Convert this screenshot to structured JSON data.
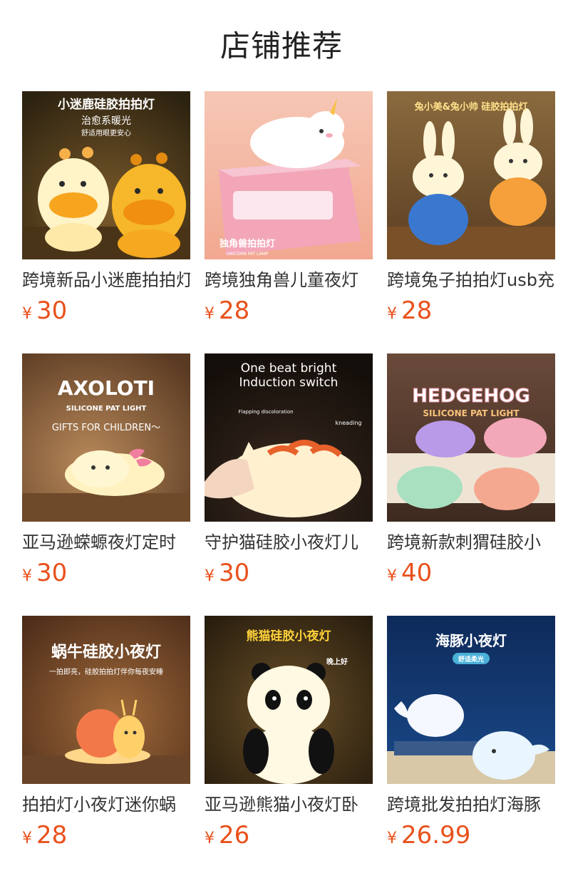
{
  "title": "店铺推荐",
  "currency_symbol": "¥",
  "products": [
    {
      "name": "跨境新品小迷鹿拍拍灯",
      "price": "30",
      "image": {
        "icon": "giraffe-lamp",
        "lines": [
          "小迷鹿硅胶拍拍灯",
          "治愈系暖光",
          "舒适用眼更安心"
        ]
      }
    },
    {
      "name": "跨境独角兽儿童夜灯",
      "price": "28",
      "image": {
        "icon": "unicorn-lamp",
        "lines": [
          "独角兽拍拍灯",
          "UNICORN PAT LAMP"
        ]
      }
    },
    {
      "name": "跨境兔子拍拍灯usb充",
      "price": "28",
      "image": {
        "icon": "rabbit-lamp",
        "lines": [
          "兔小美&兔小帅 硅胶拍拍灯"
        ]
      }
    },
    {
      "name": "亚马逊蝾螈夜灯定时",
      "price": "30",
      "image": {
        "icon": "axolotl-lamp",
        "lines": [
          "AXOLOTI",
          "SILICONE PAT LIGHT",
          "GIFTS FOR CHILDREN～"
        ]
      }
    },
    {
      "name": "守护猫硅胶小夜灯儿",
      "price": "30",
      "image": {
        "icon": "cat-lamp",
        "lines": [
          "One beat bright",
          "Induction switch",
          "Flapping discoloration",
          "kneading"
        ]
      }
    },
    {
      "name": "跨境新款刺猬硅胶小",
      "price": "40",
      "image": {
        "icon": "hedgehog-lamp",
        "lines": [
          "HEDGEHOG",
          "SILICONE PAT LIGHT"
        ]
      }
    },
    {
      "name": "拍拍灯小夜灯迷你蜗",
      "price": "28",
      "image": {
        "icon": "snail-lamp",
        "lines": [
          "蜗牛硅胶小夜灯",
          "一拍即亮，硅胶拍拍灯伴你每夜安睡"
        ]
      }
    },
    {
      "name": "亚马逊熊猫小夜灯卧",
      "price": "26",
      "image": {
        "icon": "panda-lamp",
        "lines": [
          "熊猫硅胶小夜灯",
          "晚上好"
        ]
      }
    },
    {
      "name": "跨境批发拍拍灯海豚",
      "price": "26.99",
      "image": {
        "icon": "dolphin-lamp",
        "lines": [
          "海豚小夜灯",
          "舒适柔光"
        ]
      }
    }
  ]
}
